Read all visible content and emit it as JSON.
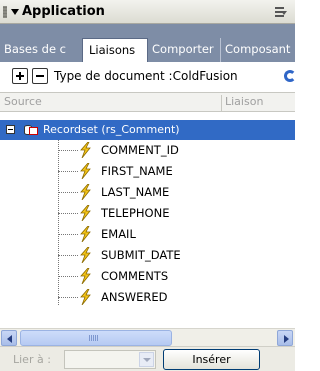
{
  "panel": {
    "title": "Application"
  },
  "tabs": [
    {
      "label": "Bases de c"
    },
    {
      "label": "Liaisons"
    },
    {
      "label": "Comporter"
    },
    {
      "label": "Composant"
    }
  ],
  "toolbar": {
    "doctype_label": "Type de document :ColdFusion"
  },
  "columns": {
    "source": "Source",
    "binding": "Liaison"
  },
  "tree": {
    "recordset_label": "Recordset (rs_Comment)",
    "fields": [
      "COMMENT_ID",
      "FIRST_NAME",
      "LAST_NAME",
      "TELEPHONE",
      "EMAIL",
      "SUBMIT_DATE",
      "COMMENTS",
      "ANSWERED"
    ]
  },
  "footer": {
    "bind_to_label": "Lier à :",
    "insert_label": "Insérer"
  },
  "colors": {
    "tabbar": "#7e8da6",
    "selection": "#316ac5",
    "bolt": "#f5c518"
  }
}
